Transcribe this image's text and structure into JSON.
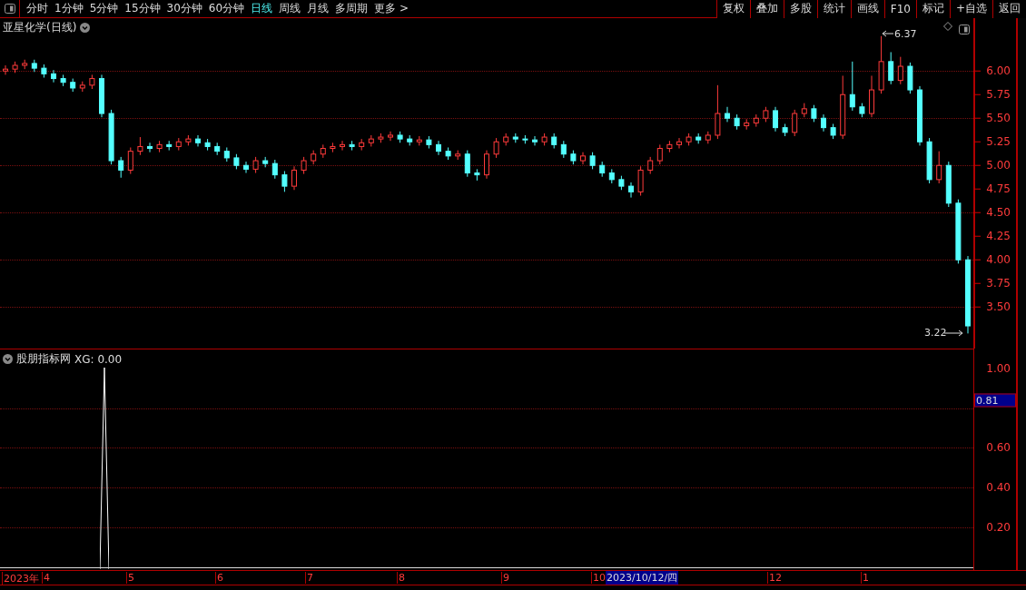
{
  "toolbar": {
    "periods": [
      {
        "label": "分时",
        "selected": false
      },
      {
        "label": "1分钟",
        "selected": false
      },
      {
        "label": "5分钟",
        "selected": false
      },
      {
        "label": "15分钟",
        "selected": false
      },
      {
        "label": "30分钟",
        "selected": false
      },
      {
        "label": "60分钟",
        "selected": false
      },
      {
        "label": "日线",
        "selected": true
      },
      {
        "label": "周线",
        "selected": false
      },
      {
        "label": "月线",
        "selected": false
      },
      {
        "label": "多周期",
        "selected": false
      },
      {
        "label": "更多 >",
        "selected": false
      }
    ],
    "actions": [
      "复权",
      "叠加",
      "多股",
      "统计",
      "画线",
      "F10",
      "标记",
      "+自选",
      "返回"
    ]
  },
  "main_chart": {
    "chart_data": {
      "type": "candlestick",
      "ylim": [
        3.06,
        6.56
      ],
      "grid": true,
      "yticks": [
        {
          "value": 6,
          "label": "6.00"
        },
        {
          "value": 5.75,
          "label": "5.75"
        },
        {
          "value": 5.5,
          "label": "5.50"
        },
        {
          "value": 5.25,
          "label": "5.25"
        },
        {
          "value": 5,
          "label": "5.00"
        },
        {
          "value": 4.75,
          "label": "4.75"
        },
        {
          "value": 4.5,
          "label": "4.50"
        },
        {
          "value": 4.25,
          "label": "4.25"
        },
        {
          "value": 4,
          "label": "4.00"
        },
        {
          "value": 3.75,
          "label": "3.75"
        },
        {
          "value": 3.5,
          "label": "3.50"
        }
      ],
      "ohlc": [
        [
          6.0,
          6.06,
          5.96,
          6.02
        ],
        [
          6.02,
          6.1,
          5.98,
          6.06
        ],
        [
          6.06,
          6.12,
          6.02,
          6.08
        ],
        [
          6.08,
          6.12,
          5.99,
          6.03
        ],
        [
          6.03,
          6.07,
          5.93,
          5.97
        ],
        [
          5.97,
          6.01,
          5.88,
          5.92
        ],
        [
          5.92,
          5.96,
          5.84,
          5.88
        ],
        [
          5.88,
          5.92,
          5.78,
          5.82
        ],
        [
          5.82,
          5.89,
          5.78,
          5.85
        ],
        [
          5.85,
          5.96,
          5.81,
          5.92
        ],
        [
          5.92,
          5.96,
          5.51,
          5.55
        ],
        [
          5.55,
          5.59,
          5.01,
          5.05
        ],
        [
          5.05,
          5.09,
          4.87,
          4.95
        ],
        [
          4.95,
          5.19,
          4.91,
          5.15
        ],
        [
          5.15,
          5.3,
          5.11,
          5.2
        ],
        [
          5.2,
          5.24,
          5.14,
          5.18
        ],
        [
          5.18,
          5.26,
          5.14,
          5.22
        ],
        [
          5.22,
          5.26,
          5.16,
          5.2
        ],
        [
          5.2,
          5.29,
          5.16,
          5.25
        ],
        [
          5.25,
          5.32,
          5.21,
          5.28
        ],
        [
          5.28,
          5.32,
          5.2,
          5.24
        ],
        [
          5.24,
          5.28,
          5.16,
          5.2
        ],
        [
          5.2,
          5.24,
          5.11,
          5.15
        ],
        [
          5.15,
          5.19,
          5.04,
          5.08
        ],
        [
          5.08,
          5.12,
          4.96,
          5.0
        ],
        [
          5.0,
          5.04,
          4.92,
          4.96
        ],
        [
          4.96,
          5.09,
          4.92,
          5.05
        ],
        [
          5.05,
          5.09,
          4.98,
          5.02
        ],
        [
          5.02,
          5.06,
          4.86,
          4.9
        ],
        [
          4.9,
          4.94,
          4.72,
          4.78
        ],
        [
          4.78,
          4.99,
          4.74,
          4.95
        ],
        [
          4.95,
          5.09,
          4.91,
          5.05
        ],
        [
          5.05,
          5.16,
          5.01,
          5.12
        ],
        [
          5.12,
          5.22,
          5.08,
          5.18
        ],
        [
          5.18,
          5.24,
          5.14,
          5.2
        ],
        [
          5.2,
          5.26,
          5.16,
          5.22
        ],
        [
          5.22,
          5.26,
          5.16,
          5.2
        ],
        [
          5.2,
          5.28,
          5.16,
          5.24
        ],
        [
          5.24,
          5.32,
          5.2,
          5.28
        ],
        [
          5.28,
          5.34,
          5.24,
          5.3
        ],
        [
          5.3,
          5.36,
          5.26,
          5.32
        ],
        [
          5.32,
          5.36,
          5.24,
          5.28
        ],
        [
          5.28,
          5.32,
          5.21,
          5.25
        ],
        [
          5.25,
          5.31,
          5.21,
          5.27
        ],
        [
          5.27,
          5.31,
          5.18,
          5.22
        ],
        [
          5.22,
          5.26,
          5.11,
          5.15
        ],
        [
          5.15,
          5.19,
          5.06,
          5.1
        ],
        [
          5.1,
          5.16,
          5.06,
          5.12
        ],
        [
          5.12,
          5.16,
          4.88,
          4.92
        ],
        [
          4.92,
          4.96,
          4.84,
          4.9
        ],
        [
          4.9,
          5.16,
          4.86,
          5.12
        ],
        [
          5.12,
          5.29,
          5.08,
          5.25
        ],
        [
          5.25,
          5.34,
          5.21,
          5.3
        ],
        [
          5.3,
          5.34,
          5.24,
          5.28
        ],
        [
          5.28,
          5.32,
          5.23,
          5.27
        ],
        [
          5.27,
          5.31,
          5.21,
          5.25
        ],
        [
          5.25,
          5.34,
          5.21,
          5.3
        ],
        [
          5.3,
          5.34,
          5.18,
          5.22
        ],
        [
          5.22,
          5.26,
          5.08,
          5.12
        ],
        [
          5.12,
          5.16,
          5.01,
          5.05
        ],
        [
          5.05,
          5.14,
          5.01,
          5.1
        ],
        [
          5.1,
          5.14,
          4.96,
          5.0
        ],
        [
          5.0,
          5.04,
          4.88,
          4.92
        ],
        [
          4.92,
          4.96,
          4.81,
          4.85
        ],
        [
          4.85,
          4.89,
          4.74,
          4.78
        ],
        [
          4.78,
          4.82,
          4.66,
          4.72
        ],
        [
          4.72,
          4.99,
          4.68,
          4.95
        ],
        [
          4.95,
          5.09,
          4.91,
          5.05
        ],
        [
          5.05,
          5.22,
          5.01,
          5.18
        ],
        [
          5.18,
          5.26,
          5.14,
          5.22
        ],
        [
          5.22,
          5.29,
          5.18,
          5.25
        ],
        [
          5.25,
          5.34,
          5.21,
          5.3
        ],
        [
          5.3,
          5.34,
          5.23,
          5.27
        ],
        [
          5.27,
          5.36,
          5.23,
          5.32
        ],
        [
          5.32,
          5.85,
          5.28,
          5.55
        ],
        [
          5.55,
          5.62,
          5.46,
          5.5
        ],
        [
          5.5,
          5.54,
          5.38,
          5.42
        ],
        [
          5.42,
          5.49,
          5.38,
          5.45
        ],
        [
          5.45,
          5.54,
          5.41,
          5.5
        ],
        [
          5.5,
          5.62,
          5.46,
          5.58
        ],
        [
          5.58,
          5.62,
          5.36,
          5.4
        ],
        [
          5.4,
          5.44,
          5.31,
          5.35
        ],
        [
          5.35,
          5.59,
          5.31,
          5.55
        ],
        [
          5.55,
          5.66,
          5.51,
          5.6
        ],
        [
          5.6,
          5.64,
          5.46,
          5.5
        ],
        [
          5.5,
          5.54,
          5.36,
          5.4
        ],
        [
          5.4,
          5.44,
          5.28,
          5.32
        ],
        [
          5.32,
          5.95,
          5.28,
          5.75
        ],
        [
          5.75,
          6.1,
          5.58,
          5.62
        ],
        [
          5.62,
          5.66,
          5.51,
          5.55
        ],
        [
          5.55,
          5.95,
          5.51,
          5.8
        ],
        [
          5.8,
          6.37,
          5.76,
          6.1
        ],
        [
          6.1,
          6.2,
          5.86,
          5.9
        ],
        [
          5.9,
          6.15,
          5.86,
          6.05
        ],
        [
          6.05,
          6.09,
          5.76,
          5.8
        ],
        [
          5.8,
          5.84,
          5.21,
          5.25
        ],
        [
          5.25,
          5.29,
          4.81,
          4.85
        ],
        [
          4.85,
          5.15,
          4.81,
          5.0
        ],
        [
          5.0,
          5.04,
          4.56,
          4.6
        ],
        [
          4.6,
          4.64,
          3.96,
          4.0
        ],
        [
          4.0,
          4.04,
          3.22,
          3.3
        ]
      ]
    },
    "title": "亚星化学(日线)",
    "high_label": "6.37",
    "low_label": "3.22"
  },
  "indicator": {
    "title": "股朋指标网",
    "reading": "XG: 0.00",
    "y_ticks": [
      "1.00",
      "0.60",
      "0.40",
      "0.20"
    ],
    "cursor_value": "0.81"
  },
  "date_axis": {
    "labels": [
      "2023年",
      "4",
      "5",
      "6",
      "7",
      "8",
      "9",
      "10",
      "12",
      "1"
    ],
    "cursor_date": "2023/10/12/四"
  }
}
